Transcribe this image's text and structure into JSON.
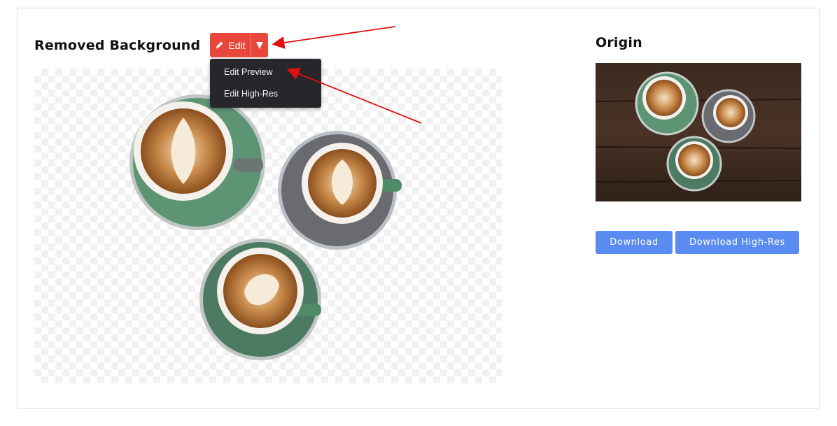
{
  "removed": {
    "title": "Removed Background",
    "edit_label": "Edit",
    "menu_items": [
      "Edit Preview",
      "Edit High-Res"
    ]
  },
  "origin": {
    "title": "Origin"
  },
  "actions": {
    "download_label": "Download",
    "download_hr_label": "Download High-Res"
  },
  "colors": {
    "edit_button": "#e8483c",
    "download_button": "#5a8bf0",
    "dropdown_bg": "#26262b",
    "annotation_arrow": "#e01010"
  },
  "icons": {
    "edit": "pencil-icon",
    "caret": "caret-down-icon"
  }
}
